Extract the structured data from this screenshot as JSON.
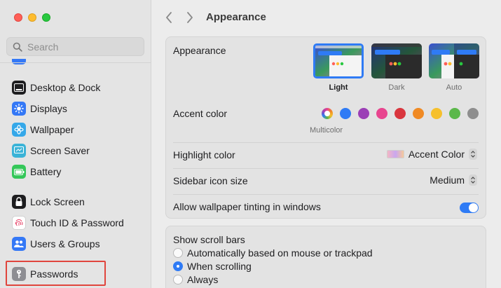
{
  "window": {
    "title": "Appearance"
  },
  "search": {
    "placeholder": "Search",
    "value": ""
  },
  "sidebar": {
    "items": [
      {
        "label": "Desktop & Dock",
        "icon": "dock-icon",
        "color": "#1d1d1f"
      },
      {
        "label": "Displays",
        "icon": "sun-icon",
        "color": "#3478f6"
      },
      {
        "label": "Wallpaper",
        "icon": "flower-icon",
        "color": "#35a8e9"
      },
      {
        "label": "Screen Saver",
        "icon": "screen-saver-icon",
        "color": "#3ab3d7"
      },
      {
        "label": "Battery",
        "icon": "battery-icon",
        "color": "#34c759"
      },
      {
        "label": "Lock Screen",
        "icon": "lock-icon",
        "color": "#1d1d1f"
      },
      {
        "label": "Touch ID & Password",
        "icon": "fingerprint-icon",
        "color": "#ffffff"
      },
      {
        "label": "Users & Groups",
        "icon": "users-icon",
        "color": "#3478f6"
      },
      {
        "label": "Passwords",
        "icon": "key-icon",
        "color": "#8e8e93"
      }
    ]
  },
  "appearance": {
    "label": "Appearance",
    "options": [
      {
        "label": "Light",
        "selected": true
      },
      {
        "label": "Dark",
        "selected": false
      },
      {
        "label": "Auto",
        "selected": false
      }
    ]
  },
  "accent": {
    "label": "Accent color",
    "selected_caption": "Multicolor",
    "colors": [
      "multicolor",
      "#2f7bf5",
      "#9b3fb6",
      "#e8458f",
      "#d9363e",
      "#f08a24",
      "#f6c02c",
      "#5bb84a",
      "#8e8e8e"
    ]
  },
  "highlight": {
    "label": "Highlight color",
    "value": "Accent Color"
  },
  "sidebar_icon_size": {
    "label": "Sidebar icon size",
    "value": "Medium"
  },
  "wallpaper_tinting": {
    "label": "Allow wallpaper tinting in windows",
    "enabled": true
  },
  "scroll_bars": {
    "label": "Show scroll bars",
    "options": [
      {
        "label": "Automatically based on mouse or trackpad",
        "selected": false
      },
      {
        "label": "When scrolling",
        "selected": true
      },
      {
        "label": "Always",
        "selected": false
      }
    ]
  }
}
